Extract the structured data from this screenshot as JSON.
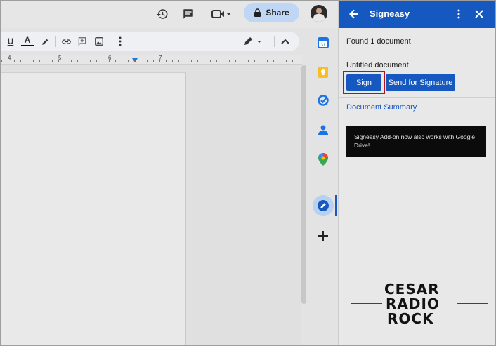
{
  "docs_topbar": {
    "share_label": "Share",
    "icons": [
      "version-history-icon",
      "comments-icon",
      "meet-icon",
      "lock-icon",
      "avatar"
    ]
  },
  "format_toolbar": {
    "underline_label": "U",
    "text_color_label": "A"
  },
  "ruler": {
    "numbers": [
      "4",
      "5",
      "6",
      "7"
    ]
  },
  "signeasy_panel": {
    "title": "Signeasy",
    "found_text": "Found 1 document",
    "document_name": "Untitled document",
    "sign_label": "Sign",
    "send_label": "Send for Signature",
    "summary_link": "Document Summary",
    "notice_text": "Signeasy Add-on now also works with Google Drive!"
  },
  "watermark": {
    "line1": "CESAR",
    "line2": "RADIO",
    "line3": "ROCK"
  },
  "colors": {
    "panel_header": "#1558c0",
    "button": "#1558c0",
    "highlight_outline": "#b5131b",
    "share_bg": "#bfd6f4"
  }
}
